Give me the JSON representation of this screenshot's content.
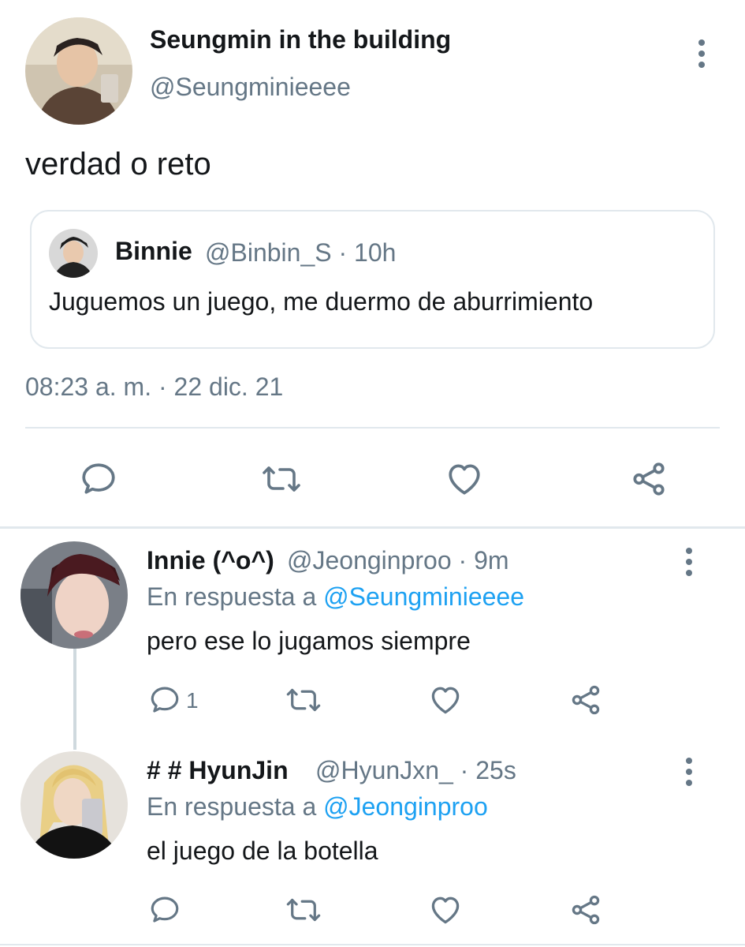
{
  "main_tweet": {
    "display_name": "Seungmin in the building",
    "handle": "@Seungminieeee",
    "text": "verdad o reto",
    "timestamp": "08:23 a. m. · 22 dic. 21",
    "quoted": {
      "display_name": "Binnie",
      "handle": "@Binbin_S · 10h",
      "text": "Juguemos un juego, me duermo de aburrimiento"
    }
  },
  "replies": [
    {
      "display_name": "Innie (^o^)",
      "handle_time": "@Jeonginproo · 9m",
      "reply_prefix": "En respuesta a ",
      "reply_to": "@Seungminieeee",
      "text": "pero ese lo jugamos siempre",
      "reply_count": "1"
    },
    {
      "display_name": "# # HyunJin",
      "handle_time": "@HyunJxn_ · 25s",
      "reply_prefix": "En respuesta a ",
      "reply_to": "@Jeonginproo",
      "text": "el juego de la botella",
      "reply_count": ""
    }
  ],
  "icons": {
    "reply": "speech-bubble-icon",
    "retweet": "retweet-icon",
    "like": "heart-icon",
    "share": "share-icon",
    "more": "kebab-menu-icon"
  },
  "colors": {
    "text": "#14171a",
    "secondary": "#657786",
    "link": "#1da1f2",
    "border": "#e1e8ed"
  }
}
